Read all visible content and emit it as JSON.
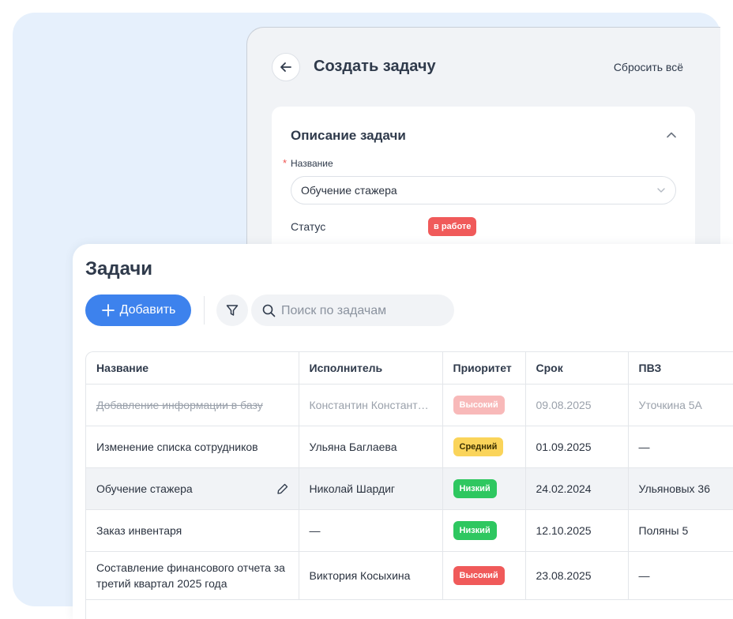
{
  "create_task": {
    "title": "Создать задачу",
    "reset_label": "Сбросить всё",
    "section_title": "Описание задачи",
    "name_label": "Название",
    "required_mark": "*",
    "name_value": "Обучение стажера",
    "status_label": "Статус",
    "status_value": "в работе"
  },
  "tasks": {
    "title": "Задачи",
    "add_label": "Добавить",
    "search_placeholder": "Поиск по задачам",
    "columns": [
      "Название",
      "Исполнитель",
      "Приоритет",
      "Срок",
      "ПВЗ"
    ],
    "rows": [
      {
        "name": "Добавление информации в базу",
        "assignee": "Константин Константинов",
        "priority": "Высокий",
        "due": "09.08.2025",
        "pvz": "Уточкина 5А"
      },
      {
        "name": "Изменение списка сотрудников",
        "assignee": "Ульяна Баглаева",
        "priority": "Средний",
        "due": "01.09.2025",
        "pvz": "—"
      },
      {
        "name": "Обучение стажера",
        "assignee": "Николай Шардиг",
        "priority": "Низкий",
        "due": "24.02.2024",
        "pvz": "Ульяновых 36"
      },
      {
        "name": "Заказ инвентаря",
        "assignee": "—",
        "priority": "Низкий",
        "due": "12.10.2025",
        "pvz": "Поляны 5"
      },
      {
        "name": "Составление финансового отчета за третий квартал 2025 года",
        "assignee": "Виктория Косыхина",
        "priority": "Высокий",
        "due": "23.08.2025",
        "pvz": "—"
      }
    ]
  },
  "colors": {
    "accent": "#3d82ed",
    "high": "#f05a5a",
    "medium": "#fad45a",
    "low": "#2ec760",
    "background_panel": "#e6f0fc"
  },
  "icons": [
    "arrow-left-icon",
    "chevron-up-icon",
    "chevron-down-icon",
    "plus-icon",
    "filter-icon",
    "search-icon",
    "pencil-icon"
  ]
}
